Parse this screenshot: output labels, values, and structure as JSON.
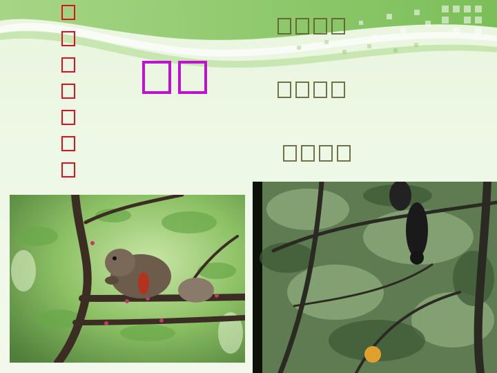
{
  "slide": {
    "vertical_title": "□□□□□□□",
    "main_title": "□□",
    "phrases": [
      "□□□□",
      "□□□□",
      "□□□□"
    ]
  },
  "images": {
    "left_photo": {
      "subject": "squirrel eating on branch",
      "watermark": ""
    },
    "right_photo": {
      "subject": "dark squirrel in tree canopy"
    }
  },
  "colors": {
    "vertical_title": "#e0101e",
    "main_title": "#c011d0",
    "phrase_text": "#5b5b2a",
    "accent_green": "#7ec05a"
  }
}
